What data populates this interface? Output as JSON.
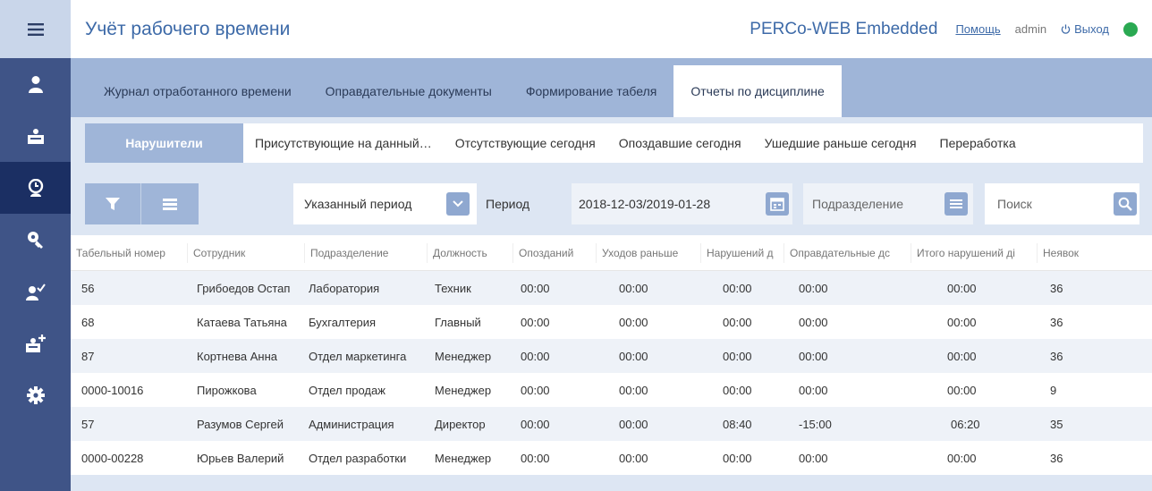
{
  "header": {
    "title": "Учёт рабочего времени",
    "brand": "PERCo-WEB Embedded",
    "help": "Помощь",
    "user": "admin",
    "logout": "Выход",
    "status_color": "#2aa952"
  },
  "sidebar": {
    "items": [
      {
        "icon": "menu-icon"
      },
      {
        "icon": "person-icon"
      },
      {
        "icon": "id-card-icon"
      },
      {
        "icon": "clock-person-icon"
      },
      {
        "icon": "key-icon"
      },
      {
        "icon": "person-check-icon"
      },
      {
        "icon": "card-add-icon"
      },
      {
        "icon": "gear-icon"
      }
    ]
  },
  "tabs": [
    {
      "label": "Журнал отработанного времени"
    },
    {
      "label": "Оправдательные документы"
    },
    {
      "label": "Формирование табеля"
    },
    {
      "label": "Отчеты по дисциплине"
    }
  ],
  "subtabs": [
    {
      "label": "Нарушители"
    },
    {
      "label": "Присутствующие на данный…"
    },
    {
      "label": "Отсутствующие сегодня"
    },
    {
      "label": "Опоздавшие сегодня"
    },
    {
      "label": "Ушедшие раньше сегодня"
    },
    {
      "label": "Переработка"
    }
  ],
  "toolbar": {
    "period_select": "Указанный период",
    "period_label": "Период",
    "period_value": "2018-12-03/2019-01-28",
    "department_placeholder": "Подразделение",
    "search_placeholder": "Поиск"
  },
  "table": {
    "columns": [
      "Табельный номер",
      "Сотрудник",
      "Подразделение",
      "Должность",
      "Опозданий",
      "Уходов раньше",
      "Нарушений д",
      "Оправдательные дс",
      "Итого нарушений ді",
      "Неявок"
    ],
    "rows": [
      [
        "56",
        "Грибоедов Остап",
        "Лаборатория",
        "Техник",
        "00:00",
        "00:00",
        "00:00",
        "00:00",
        "00:00",
        "36"
      ],
      [
        "68",
        "Катаева Татьяна",
        "Бухгалтерия",
        "Главный",
        "00:00",
        "00:00",
        "00:00",
        "00:00",
        "00:00",
        "36"
      ],
      [
        "87",
        "Кортнева Анна",
        "Отдел маркетинга",
        "Менеджер",
        "00:00",
        "00:00",
        "00:00",
        "00:00",
        "00:00",
        "36"
      ],
      [
        "0000-10016",
        "Пирожкова",
        "Отдел продаж",
        "Менеджер",
        "00:00",
        "00:00",
        "00:00",
        "00:00",
        "00:00",
        "9"
      ],
      [
        "57",
        "Разумов Сергей",
        "Администрация",
        "Директор",
        "00:00",
        "00:00",
        "08:40",
        "-15:00",
        "06:20",
        "35"
      ],
      [
        "0000-00228",
        "Юрьев Валерий",
        "Отдел разработки",
        "Менеджер",
        "00:00",
        "00:00",
        "00:00",
        "00:00",
        "00:00",
        "36"
      ]
    ]
  }
}
